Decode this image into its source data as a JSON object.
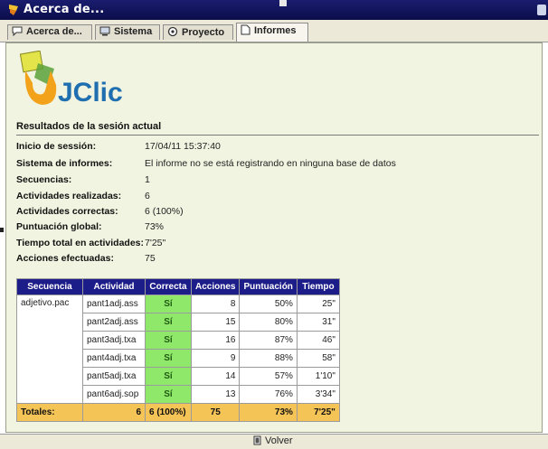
{
  "window": {
    "title": "Acerca de..."
  },
  "tabs": [
    {
      "label": "Acerca de...",
      "icon": "speech-bubble-icon",
      "active": false
    },
    {
      "label": "Sistema",
      "icon": "computer-icon",
      "active": false
    },
    {
      "label": "Proyecto",
      "icon": "gear-icon",
      "active": false
    },
    {
      "label": "Informes",
      "icon": "document-icon",
      "active": true
    }
  ],
  "logo": {
    "text": "JClic",
    "colors": {
      "yellow": "#d9d92a",
      "orange": "#f2a21b",
      "blue": "#1f6fb0"
    }
  },
  "report": {
    "section_title": "Resultados de la sesión actual",
    "fields": [
      {
        "label": "Inicio de sessión:",
        "value": "17/04/11 15:37:40"
      },
      {
        "label": "Sistema de informes:",
        "value": "El informe no se está registrando en ninguna base de datos"
      },
      {
        "label": "Secuencias:",
        "value": "1"
      },
      {
        "label": "Actividades realizadas:",
        "value": "6"
      },
      {
        "label": "Actividades correctas:",
        "value": "6 (100%)"
      },
      {
        "label": "Puntuación global:",
        "value": "73%"
      },
      {
        "label": "Tiempo total en actividades:",
        "value": "7'25\""
      },
      {
        "label": "Acciones efectuadas:",
        "value": "75"
      }
    ]
  },
  "table": {
    "headers": [
      "Secuencia",
      "Actividad",
      "Correcta",
      "Acciones",
      "Puntuación",
      "Tiempo"
    ],
    "sequence": "adjetivo.pac",
    "rows": [
      {
        "actividad": "pant1adj.ass",
        "correcta": "Sí",
        "acciones": "8",
        "puntuacion": "50%",
        "tiempo": "25\""
      },
      {
        "actividad": "pant2adj.ass",
        "correcta": "Sí",
        "acciones": "15",
        "puntuacion": "80%",
        "tiempo": "31\""
      },
      {
        "actividad": "pant3adj.txa",
        "correcta": "Sí",
        "acciones": "16",
        "puntuacion": "87%",
        "tiempo": "46\""
      },
      {
        "actividad": "pant4adj.txa",
        "correcta": "Sí",
        "acciones": "9",
        "puntuacion": "88%",
        "tiempo": "58\""
      },
      {
        "actividad": "pant5adj.txa",
        "correcta": "Sí",
        "acciones": "14",
        "puntuacion": "57%",
        "tiempo": "1'10\""
      },
      {
        "actividad": "pant6adj.sop",
        "correcta": "Sí",
        "acciones": "13",
        "puntuacion": "76%",
        "tiempo": "3'34\""
      }
    ],
    "totals": {
      "label": "Totales:",
      "actividades": "6",
      "correcta": "6 (100%)",
      "acciones": "75",
      "puntuacion": "73%",
      "tiempo": "7'25\""
    },
    "colors": {
      "header": "#1d1d8a",
      "correct": "#8fe86a",
      "totals": "#f5c457"
    }
  },
  "footer": {
    "button_label": "Volver",
    "icon": "door-icon"
  }
}
